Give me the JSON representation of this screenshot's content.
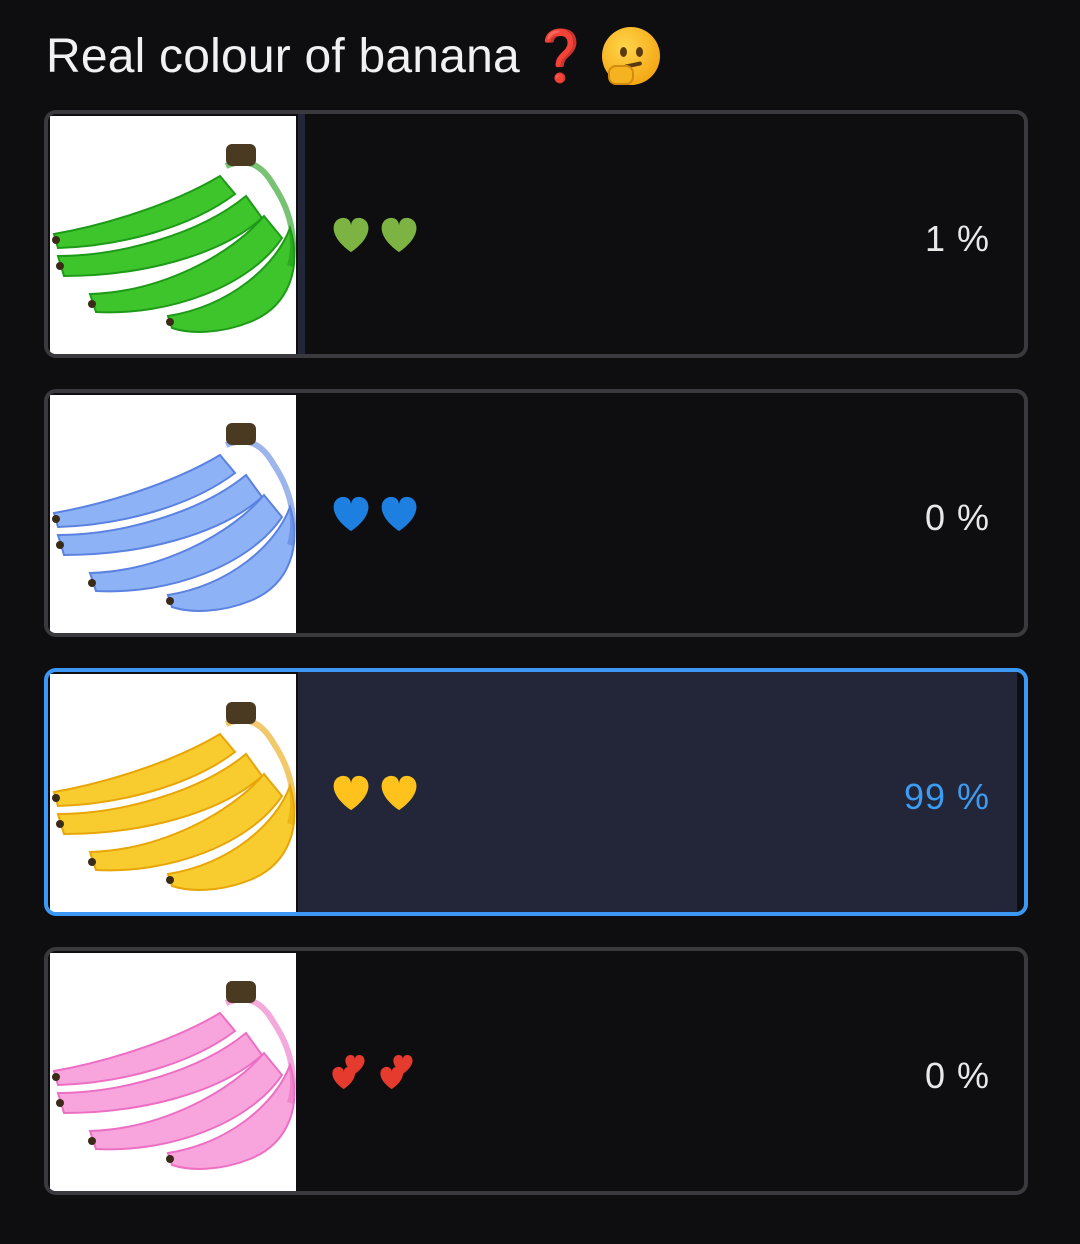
{
  "poll": {
    "question": "Real colour of banana",
    "question_emojis": [
      "question-mark-icon",
      "thinking-face-icon"
    ],
    "options": [
      {
        "id": "green",
        "hearts": "💚💚",
        "heart_color": "#7db342",
        "banana_color": "#3fc52c",
        "banana_shade": "#1e9a18",
        "percent_label": "1 %",
        "percent": 1,
        "selected": false
      },
      {
        "id": "blue",
        "hearts": "💙💙",
        "heart_color": "#1d7fe0",
        "banana_color": "#8db2f5",
        "banana_shade": "#5b82e0",
        "percent_label": "0 %",
        "percent": 0,
        "selected": false
      },
      {
        "id": "yellow",
        "hearts": "💛💛",
        "heart_color": "#ffc21c",
        "banana_color": "#f8cc2e",
        "banana_shade": "#e7a508",
        "percent_label": "99 %",
        "percent": 99,
        "selected": true
      },
      {
        "id": "pink",
        "hearts": "💕💕",
        "heart_color": "#e53a2e",
        "banana_color": "#f9a5dd",
        "banana_shade": "#ec6fc4",
        "percent_label": "0 %",
        "percent": 0,
        "selected": false
      }
    ],
    "accent_color": "#3b99f3"
  }
}
